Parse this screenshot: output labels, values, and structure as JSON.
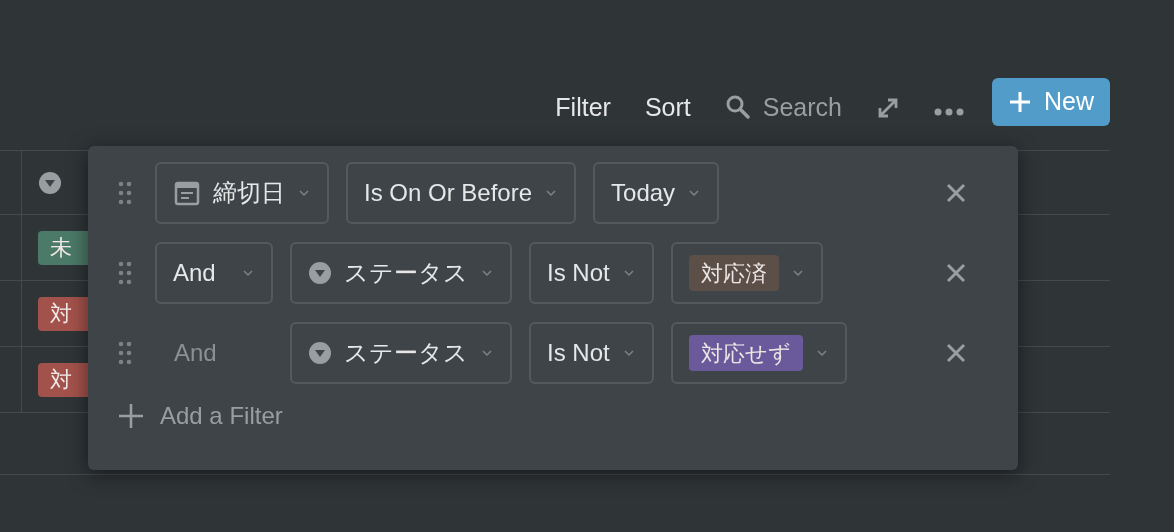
{
  "toolbar": {
    "filter": "Filter",
    "sort": "Sort",
    "search_placeholder": "Search",
    "new_button": "New"
  },
  "table": {
    "rows": [
      {
        "tag": "未",
        "color": "#4b7a69"
      },
      {
        "tag": "対",
        "color": "#a3524b"
      },
      {
        "tag": "対",
        "color": "#a3524b"
      }
    ]
  },
  "filter_popup": {
    "rows": [
      {
        "conjunction": null,
        "property": {
          "kind": "date",
          "label": "締切日"
        },
        "operator": "Is On Or Before",
        "value": {
          "kind": "text",
          "label": "Today"
        }
      },
      {
        "conjunction": {
          "kind": "select",
          "label": "And"
        },
        "property": {
          "kind": "select",
          "label": "ステータス"
        },
        "operator": "Is Not",
        "value": {
          "kind": "tag",
          "label": "対応済",
          "color": "#5c4f48"
        }
      },
      {
        "conjunction": {
          "kind": "plain",
          "label": "And"
        },
        "property": {
          "kind": "select",
          "label": "ステータス"
        },
        "operator": "Is Not",
        "value": {
          "kind": "tag",
          "label": "対応せず",
          "color": "#6a5a9b"
        }
      }
    ],
    "add_filter": "Add a Filter"
  }
}
